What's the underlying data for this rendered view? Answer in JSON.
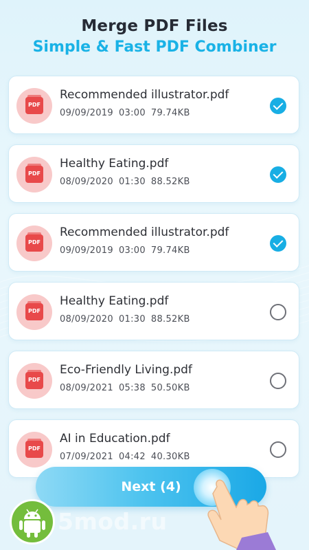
{
  "header": {
    "title": "Merge PDF Files",
    "subtitle": "Simple & Fast PDF Combiner"
  },
  "files": [
    {
      "name": "Recommended illustrator.pdf",
      "date": "09/09/2019",
      "time": "03:00",
      "size": "79.74KB",
      "icon_label": "PDF",
      "selected": true
    },
    {
      "name": "Healthy Eating.pdf",
      "date": "08/09/2020",
      "time": "01:30",
      "size": "88.52KB",
      "icon_label": "PDF",
      "selected": true
    },
    {
      "name": "Recommended illustrator.pdf",
      "date": "09/09/2019",
      "time": "03:00",
      "size": "79.74KB",
      "icon_label": "PDF",
      "selected": true
    },
    {
      "name": "Healthy Eating.pdf",
      "date": "08/09/2020",
      "time": "01:30",
      "size": "88.52KB",
      "icon_label": "PDF",
      "selected": false
    },
    {
      "name": "Eco-Friendly Living.pdf",
      "date": "08/09/2021",
      "time": "05:38",
      "size": "50.50KB",
      "icon_label": "PDF",
      "selected": false
    },
    {
      "name": "AI in Education.pdf",
      "date": "07/09/2021",
      "time": "04:42",
      "size": "40.30KB",
      "icon_label": "PDF",
      "selected": false
    }
  ],
  "next_button": {
    "label": "Next (4)"
  },
  "watermark": {
    "text": "5mod.ru"
  },
  "icons": {
    "file": "pdf-file-icon",
    "checked": "checkmark-circle-icon",
    "unchecked": "empty-circle-icon",
    "hand": "pointing-hand-icon",
    "android": "android-robot-icon"
  },
  "colors": {
    "accent": "#18aee4",
    "pdf_red": "#e8494a",
    "pdf_bg": "#f8c9c9",
    "title": "#262b35"
  }
}
